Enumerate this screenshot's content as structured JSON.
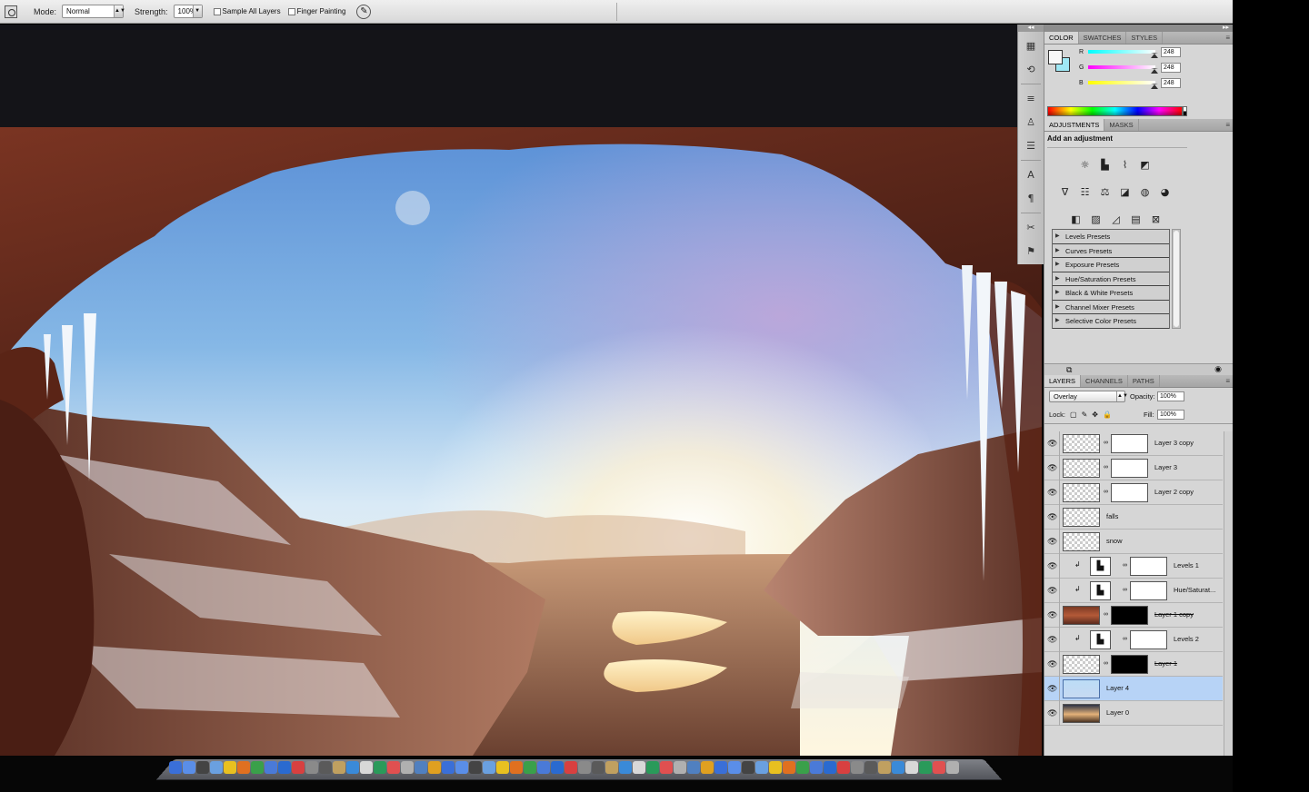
{
  "options_bar": {
    "mode_label": "Mode:",
    "mode_value": "Normal",
    "strength_label": "Strength:",
    "strength_value": "100%",
    "sample_all_layers": "Sample All Layers",
    "finger_painting": "Finger Painting",
    "icons": [
      "tool-preset-icon",
      "pressure-icon"
    ]
  },
  "color_panel": {
    "tabs": [
      "COLOR",
      "SWATCHES",
      "STYLES"
    ],
    "active_tab": "COLOR",
    "channels": [
      {
        "label": "R",
        "value": "248",
        "color": "#e84a4a"
      },
      {
        "label": "G",
        "value": "248",
        "color": "#3ac43a"
      },
      {
        "label": "B",
        "value": "248",
        "color": "#4a6ae8"
      }
    ],
    "foreground_color": "#f8f8f8",
    "background_color": "#9fe8f5"
  },
  "adjustments_panel": {
    "tabs": [
      "ADJUSTMENTS",
      "MASKS"
    ],
    "active_tab": "ADJUSTMENTS",
    "title": "Add an adjustment",
    "presets": [
      "Levels Presets",
      "Curves Presets",
      "Exposure Presets",
      "Hue/Saturation Presets",
      "Black & White Presets",
      "Channel Mixer Presets",
      "Selective Color Presets"
    ]
  },
  "layers_panel": {
    "tabs": [
      "LAYERS",
      "CHANNELS",
      "PATHS"
    ],
    "active_tab": "LAYERS",
    "blend_mode": "Overlay",
    "opacity_label": "Opacity:",
    "opacity_value": "100%",
    "lock_label": "Lock:",
    "fill_label": "Fill:",
    "fill_value": "100%",
    "layers": [
      {
        "name": "Layer 3 copy",
        "kind": "mask",
        "selected": false
      },
      {
        "name": "Layer 3",
        "kind": "mask",
        "selected": false
      },
      {
        "name": "Layer 2 copy",
        "kind": "mask",
        "selected": false
      },
      {
        "name": "falls",
        "kind": "plain",
        "selected": false
      },
      {
        "name": "snow",
        "kind": "plain",
        "selected": false
      },
      {
        "name": "Levels 1",
        "kind": "adjustment",
        "selected": false
      },
      {
        "name": "Hue/Saturat...",
        "kind": "adjustment",
        "selected": false
      },
      {
        "name": "Layer 1 copy",
        "kind": "photo-mask",
        "selected": false
      },
      {
        "name": "Levels 2",
        "kind": "adjustment",
        "selected": false
      },
      {
        "name": "Layer 1",
        "kind": "photo-mask-black",
        "selected": false
      },
      {
        "name": "Layer 4",
        "kind": "sky",
        "selected": true
      },
      {
        "name": "Layer 0",
        "kind": "land",
        "selected": false
      }
    ]
  }
}
